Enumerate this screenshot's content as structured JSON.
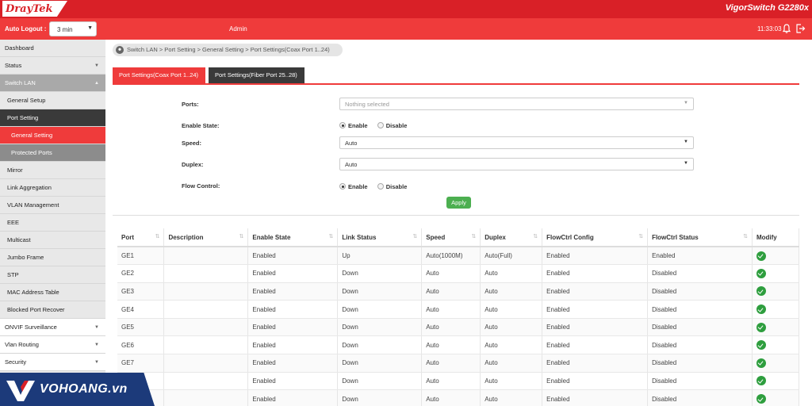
{
  "brand": {
    "logo_text": "DrayTek",
    "model": "VigorSwitch G2280x"
  },
  "header": {
    "auto_logout_label": "Auto Logout :",
    "auto_logout_value": "3 min",
    "user": "Admin",
    "time": "11:33:03",
    "icons": [
      "bell-icon",
      "logout-icon"
    ]
  },
  "sidebar": {
    "items": [
      {
        "label": "Dashboard"
      },
      {
        "label": "Status"
      },
      {
        "label": "Switch LAN"
      },
      {
        "label": "General Setup"
      },
      {
        "label": "Port Setting"
      },
      {
        "label": "General Setting"
      },
      {
        "label": "Protected Ports"
      },
      {
        "label": "Mirror"
      },
      {
        "label": "Link Aggregation"
      },
      {
        "label": "VLAN Management"
      },
      {
        "label": "EEE"
      },
      {
        "label": "Multicast"
      },
      {
        "label": "Jumbo Frame"
      },
      {
        "label": "STP"
      },
      {
        "label": "MAC Address Table"
      },
      {
        "label": "Blocked Port Recover"
      },
      {
        "label": "ONVIF Surveillance"
      },
      {
        "label": "Vlan Routing"
      },
      {
        "label": "Security"
      }
    ]
  },
  "breadcrumb": "Switch LAN > Port Setting > General Setting  > Port Settings(Coax Port 1..24)",
  "tabs": [
    {
      "label": "Port Settings(Coax Port 1..24)"
    },
    {
      "label": "Port Settings(Fiber Port 25..28)"
    }
  ],
  "form": {
    "ports_label": "Ports:",
    "ports_placeholder": "Nothing selected",
    "enable_state_label": "Enable State:",
    "speed_label": "Speed:",
    "speed_value": "Auto",
    "duplex_label": "Duplex:",
    "duplex_value": "Auto",
    "flow_control_label": "Flow Control:",
    "enable_label": "Enable",
    "disable_label": "Disable",
    "apply_label": "Apply"
  },
  "table": {
    "headers": [
      "Port",
      "Description",
      "Enable State",
      "Link Status",
      "Speed",
      "Duplex",
      "FlowCtrl Config",
      "FlowCtrl Status",
      "Modify"
    ],
    "rows": [
      [
        "GE1",
        "",
        "Enabled",
        "Up",
        "Auto(1000M)",
        "Auto(Full)",
        "Enabled",
        "Enabled"
      ],
      [
        "GE2",
        "",
        "Enabled",
        "Down",
        "Auto",
        "Auto",
        "Enabled",
        "Disabled"
      ],
      [
        "GE3",
        "",
        "Enabled",
        "Down",
        "Auto",
        "Auto",
        "Enabled",
        "Disabled"
      ],
      [
        "GE4",
        "",
        "Enabled",
        "Down",
        "Auto",
        "Auto",
        "Enabled",
        "Disabled"
      ],
      [
        "GE5",
        "",
        "Enabled",
        "Down",
        "Auto",
        "Auto",
        "Enabled",
        "Disabled"
      ],
      [
        "GE6",
        "",
        "Enabled",
        "Down",
        "Auto",
        "Auto",
        "Enabled",
        "Disabled"
      ],
      [
        "GE7",
        "",
        "Enabled",
        "Down",
        "Auto",
        "Auto",
        "Enabled",
        "Disabled"
      ],
      [
        "",
        "",
        "Enabled",
        "Down",
        "Auto",
        "Auto",
        "Enabled",
        "Disabled"
      ],
      [
        "",
        "",
        "Enabled",
        "Down",
        "Auto",
        "Auto",
        "Enabled",
        "Disabled"
      ]
    ]
  },
  "watermark": {
    "text": "VOHOANG.vn"
  },
  "colors": {
    "red": "#ef3b3b",
    "brand_red": "#d92027",
    "dark": "#3a3a3a",
    "green": "#4caf50",
    "watermark_blue": "#1c3a7a"
  }
}
